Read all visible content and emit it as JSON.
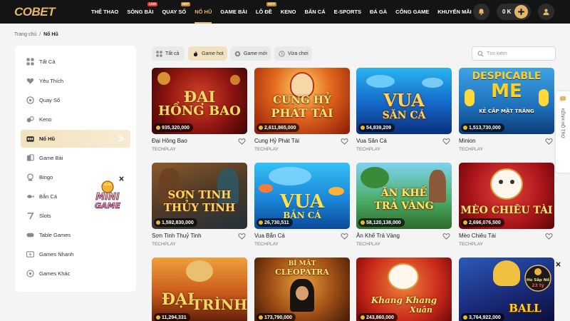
{
  "header": {
    "logo": "COBET",
    "nav": [
      {
        "label": "THỂ THAO",
        "badge": ""
      },
      {
        "label": "SÒNG BÀI",
        "badge": "LIVE"
      },
      {
        "label": "QUAY SỐ",
        "badge": "HOT"
      },
      {
        "label": "NỔ HŨ",
        "badge": ""
      },
      {
        "label": "GAME BÀI",
        "badge": ""
      },
      {
        "label": "LÔ ĐỀ",
        "badge": "HOT"
      },
      {
        "label": "KENO",
        "badge": ""
      },
      {
        "label": "BẮN CÁ",
        "badge": ""
      },
      {
        "label": "E-SPORTS",
        "badge": ""
      },
      {
        "label": "ĐÁ GÀ",
        "badge": ""
      },
      {
        "label": "CỔNG GAME",
        "badge": ""
      },
      {
        "label": "KHUYẾN MÃI",
        "badge": ""
      }
    ],
    "active_nav": "NỔ HŨ",
    "balance": "0 K",
    "accent_color": "#e2b76a"
  },
  "breadcrumb": {
    "home": "Trang chủ",
    "separator": "/",
    "current": "Nổ Hũ"
  },
  "sidebar": {
    "items": [
      {
        "label": "Tất Cả",
        "icon": "grid-icon"
      },
      {
        "label": "Yêu Thích",
        "icon": "heart-icon"
      },
      {
        "label": "Quay Số",
        "icon": "lottery-icon"
      },
      {
        "label": "Keno",
        "icon": "keno-icon"
      },
      {
        "label": "Nổ Hũ",
        "icon": "slot-machine-icon"
      },
      {
        "label": "Game Bài",
        "icon": "cards-icon"
      },
      {
        "label": "Bingo",
        "icon": "bingo-icon"
      },
      {
        "label": "Bắn Cá",
        "icon": "fish-icon"
      },
      {
        "label": "Slots",
        "icon": "seven-icon"
      },
      {
        "label": "Table Games",
        "icon": "table-icon"
      },
      {
        "label": "Games Nhanh",
        "icon": "lightning-icon"
      },
      {
        "label": "Games Khác",
        "icon": "more-icon"
      }
    ],
    "active_item": "Nổ Hũ",
    "minigame_text": [
      "MINI",
      "GAME"
    ]
  },
  "filters": {
    "tabs": [
      {
        "label": "Tất cả",
        "icon": "grid-icon"
      },
      {
        "label": "Game hot",
        "icon": "fire-icon"
      },
      {
        "label": "Game mới",
        "icon": "new-icon"
      },
      {
        "label": "Vừa chơi",
        "icon": "clock-icon"
      }
    ],
    "active_tab": "Game hot",
    "search_placeholder": "Tìm kiếm"
  },
  "games": [
    {
      "name": "Đại Hồng Bao",
      "provider": "TECHPLAY",
      "jackpot": "935,320,000",
      "thumb_title": [
        "ĐẠI",
        "HỒNG BAO"
      ]
    },
    {
      "name": "Cung Hỷ Phát Tài",
      "provider": "TECHPLAY",
      "jackpot": "2,611,865,000",
      "thumb_title": [
        "CUNG HỶ",
        "PHÁT TÀI"
      ]
    },
    {
      "name": "Vua Săn Cá",
      "provider": "TECHPLAY",
      "jackpot": "54,839,209",
      "thumb_title": [
        "VUA",
        "SĂN CÁ"
      ]
    },
    {
      "name": "Minion",
      "provider": "TECHPLAY",
      "jackpot": "1,513,730,000",
      "thumb_title": [
        "DESPICABLE",
        "ME",
        "KẺ CẮP MẶT TRĂNG"
      ]
    },
    {
      "name": "Sơn Tinh Thuỷ Tinh",
      "provider": "TECHPLAY",
      "jackpot": "1,592,830,000",
      "thumb_title": [
        "SƠN TINH",
        "THỦY TINH"
      ]
    },
    {
      "name": "Vua Bắn Cá",
      "provider": "TECHPLAY",
      "jackpot": "26,730,511",
      "thumb_title": [
        "VUA",
        "BẮN CÁ"
      ]
    },
    {
      "name": "Ăn Khế Trả Vàng",
      "provider": "TECHPLAY",
      "jackpot": "58,120,138,000",
      "thumb_title": [
        "ĂN KHẾ",
        "TRẢ VÀNG"
      ]
    },
    {
      "name": "Mèo Chiêu Tài",
      "provider": "TECHPLAY",
      "jackpot": "2,696,076,500",
      "thumb_title": [
        "MÈO CHIÊU TÀI"
      ]
    },
    {
      "name": "",
      "provider": "",
      "jackpot": "11,294,331",
      "thumb_title": [
        "ĐẠI",
        "TRÌNH"
      ]
    },
    {
      "name": "",
      "provider": "",
      "jackpot": "173,790,000",
      "thumb_title": [
        "BÍ MẬT",
        "CLEOPATRA"
      ]
    },
    {
      "name": "",
      "provider": "",
      "jackpot": "243,860,000",
      "thumb_title": [
        "Khang Khang",
        "Xuân"
      ]
    },
    {
      "name": "",
      "provider": "",
      "jackpot": "3,764,922,000",
      "thumb_title": [
        "BALL"
      ]
    }
  ],
  "float": {
    "support_label": "KÊNH HỖ TRỢ",
    "jackpot_badge_title": "Hũ Sắp Nổ",
    "jackpot_badge_value": "23 tỷ"
  }
}
